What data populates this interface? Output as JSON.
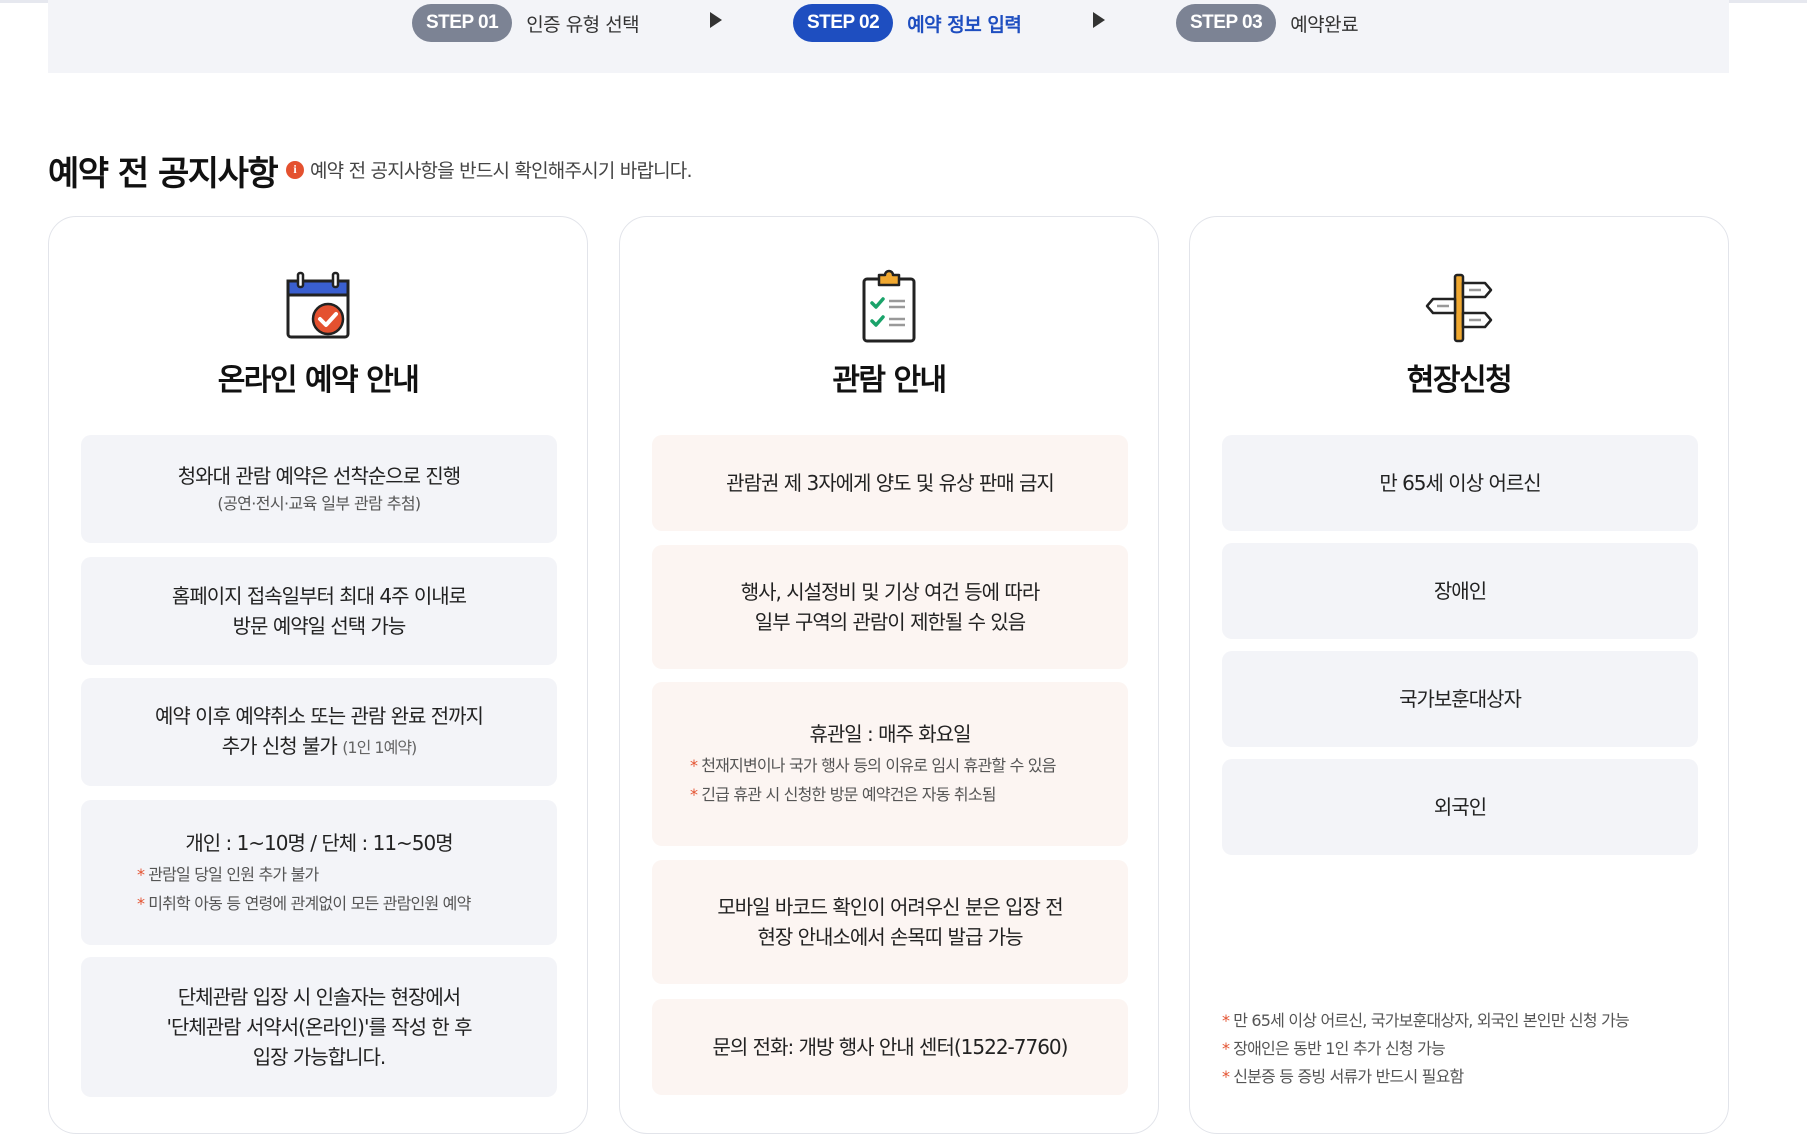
{
  "steps": [
    {
      "badge": "STEP 01",
      "label": "인증 유형 선택",
      "active": false
    },
    {
      "badge": "STEP 02",
      "label": "예약 정보 입력",
      "active": true
    },
    {
      "badge": "STEP 03",
      "label": "예약완료",
      "active": false
    }
  ],
  "section": {
    "title": "예약 전 공지사항",
    "notice_icon": "i",
    "notice": "예약 전 공지사항을 반드시 확인해주시기 바랍니다."
  },
  "cards": {
    "online": {
      "icon": "calendar-check-icon",
      "title": "온라인 예약 안내",
      "box1": {
        "line": "청와대 관람 예약은 선착순으로 진행",
        "sub": "(공연·전시·교육 일부 관람 추첨)"
      },
      "box2": {
        "line1": "홈페이지 접속일부터 최대 4주 이내로",
        "line2": "방문 예약일 선택 가능"
      },
      "box3": {
        "line1": "예약 이후 예약취소 또는 관람 완료 전까지",
        "line2": "추가 신청 불가",
        "paren": "(1인 1예약)"
      },
      "box4": {
        "line": "개인 : 1~10명 / 단체 : 11~50명",
        "note1": "관람일 당일 인원 추가 불가",
        "note2": "미취학 아동 등 연령에 관계없이 모든 관람인원 예약"
      },
      "box5": {
        "line1": "단체관람 입장 시 인솔자는 현장에서",
        "line2": "'단체관람 서약서(온라인)'를 작성 한 후",
        "line3": "입장 가능합니다."
      }
    },
    "visit": {
      "icon": "clipboard-checklist-icon",
      "title": "관람 안내",
      "box1": {
        "line": "관람권 제 3자에게 양도 및 유상 판매 금지"
      },
      "box2": {
        "line1": "행사, 시설정비 및 기상 여건 등에 따라",
        "line2": "일부 구역의 관람이 제한될 수 있음"
      },
      "box3": {
        "line": "휴관일 : 매주 화요일",
        "note1": "천재지변이나 국가 행사 등의 이유로 임시 휴관할 수 있음",
        "note2": "긴급 휴관 시 신청한 방문 예약건은 자동 취소됨"
      },
      "box4": {
        "line1": "모바일 바코드 확인이 어려우신 분은 입장 전",
        "line2": "현장 안내소에서 손목띠 발급 가능"
      },
      "box5": {
        "line": "문의 전화: 개방 행사 안내 센터(1522-7760)"
      }
    },
    "onsite": {
      "icon": "signpost-icon",
      "title": "현장신청",
      "items": [
        "만 65세 이상 어르신",
        "장애인",
        "국가보훈대상자",
        "외국인"
      ],
      "notes": [
        "만 65세 이상 어르신, 국가보훈대상자, 외국인 본인만 신청 가능",
        "장애인은 동반 1인 추가 신청 가능",
        "신분증 등 증빙 서류가 반드시 필요함"
      ]
    }
  },
  "note_marker": "*",
  "colors": {
    "accent": "#1e4ec0",
    "badge_inactive": "#7c8394",
    "star": "#e4512f",
    "gray_box": "#f3f4f8",
    "peach_box": "#fcf5f2"
  }
}
